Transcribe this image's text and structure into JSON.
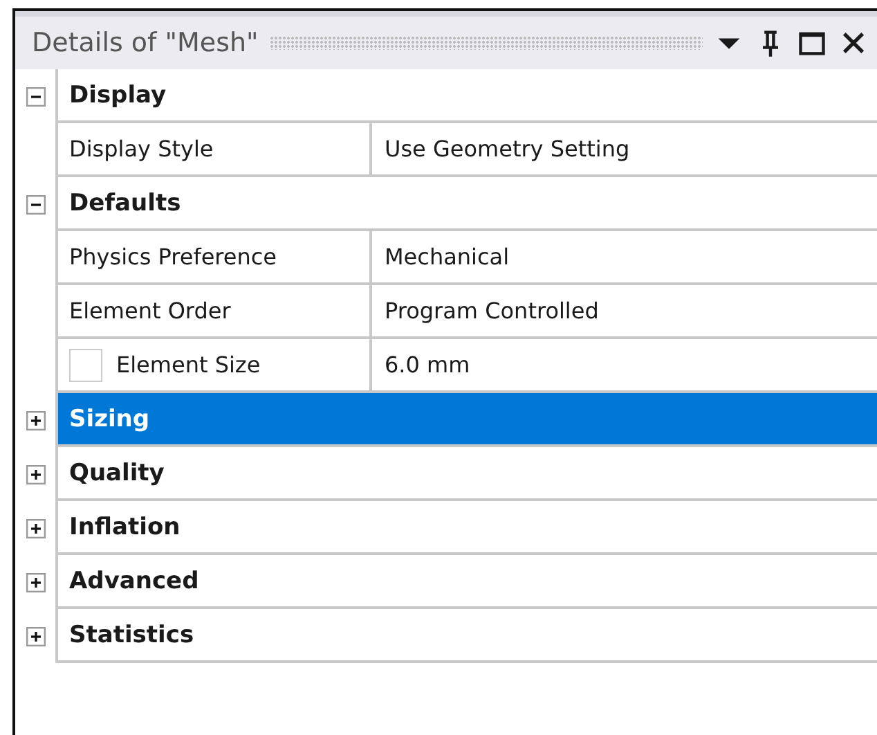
{
  "panel": {
    "title": "Details of \"Mesh\""
  },
  "groups": [
    {
      "name": "Display",
      "expanded": true,
      "selected": false,
      "rows": [
        {
          "label": "Display Style",
          "value": "Use Geometry Setting"
        }
      ]
    },
    {
      "name": "Defaults",
      "expanded": true,
      "selected": false,
      "rows": [
        {
          "label": "Physics Preference",
          "value": "Mechanical"
        },
        {
          "label": "Element Order",
          "value": "Program Controlled"
        },
        {
          "label": "Element Size",
          "value": "6.0 mm",
          "kind": "checkbox",
          "checked": false
        }
      ]
    },
    {
      "name": "Sizing",
      "expanded": false,
      "selected": true
    },
    {
      "name": "Quality",
      "expanded": false,
      "selected": false
    },
    {
      "name": "Inflation",
      "expanded": false,
      "selected": false
    },
    {
      "name": "Advanced",
      "expanded": false,
      "selected": false
    },
    {
      "name": "Statistics",
      "expanded": false,
      "selected": false
    }
  ]
}
